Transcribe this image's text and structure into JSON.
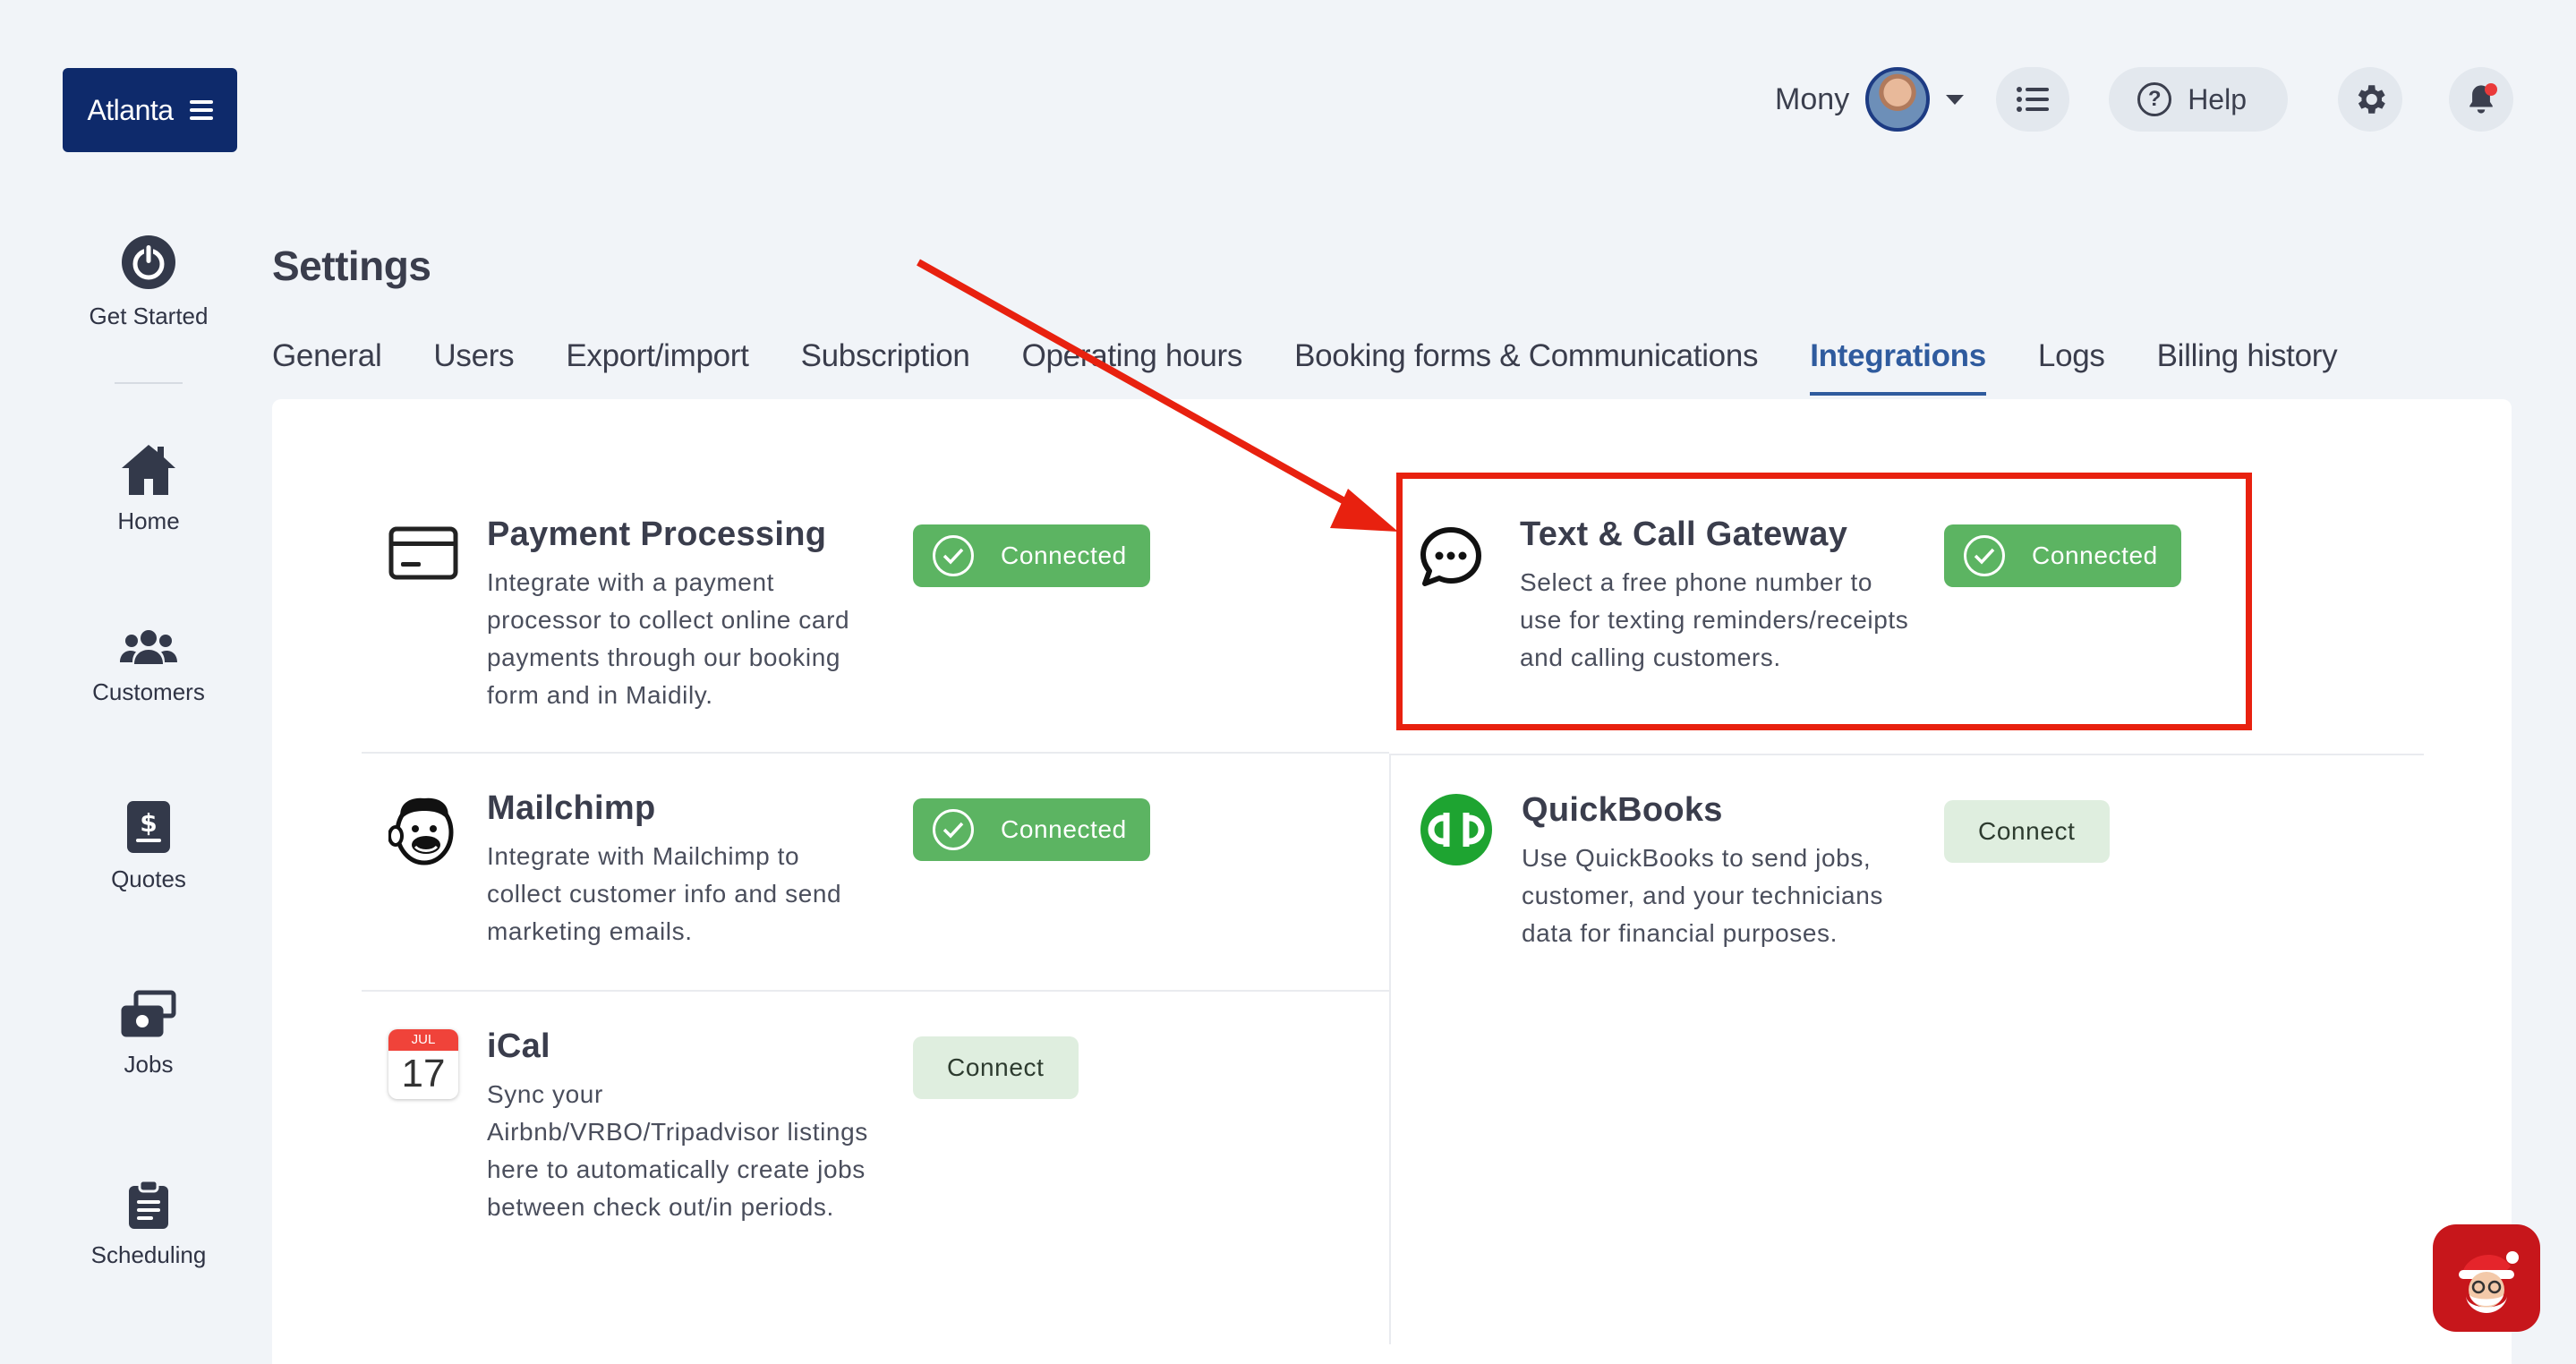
{
  "header": {
    "brand": "Atlanta",
    "user_name": "Mony",
    "help_label": "Help",
    "icons": [
      "menu-icon",
      "list-icon",
      "help-icon",
      "gear-icon",
      "bell-icon"
    ]
  },
  "sidebar": {
    "items": [
      {
        "label": "Get Started",
        "icon": "power-icon"
      },
      {
        "label": "Home",
        "icon": "home-icon"
      },
      {
        "label": "Customers",
        "icon": "users-icon"
      },
      {
        "label": "Quotes",
        "icon": "quote-icon"
      },
      {
        "label": "Jobs",
        "icon": "jobs-icon"
      },
      {
        "label": "Scheduling",
        "icon": "clipboard-icon"
      }
    ]
  },
  "page": {
    "title": "Settings",
    "tabs": [
      {
        "label": "General"
      },
      {
        "label": "Users"
      },
      {
        "label": "Export/import"
      },
      {
        "label": "Subscription"
      },
      {
        "label": "Operating hours"
      },
      {
        "label": "Booking forms & Communications"
      },
      {
        "label": "Integrations",
        "active": true
      },
      {
        "label": "Logs"
      },
      {
        "label": "Billing history"
      }
    ]
  },
  "integrations": {
    "payment": {
      "title": "Payment Processing",
      "desc": "Integrate with a payment processor to collect online card payments through our booking form and in Maidily.",
      "status": "Connected"
    },
    "gateway": {
      "title": "Text & Call Gateway",
      "desc": "Select a free phone number to use for texting reminders/receipts and calling customers.",
      "status": "Connected"
    },
    "mailchimp": {
      "title": "Mailchimp",
      "desc": "Integrate with Mailchimp to collect customer info and send marketing emails.",
      "status": "Connected"
    },
    "quickbooks": {
      "title": "QuickBooks",
      "desc": "Use QuickBooks to send jobs, customer, and your technicians data for financial purposes.",
      "action": "Connect"
    },
    "ical": {
      "title": "iCal",
      "desc": "Sync your Airbnb/VRBO/Tripadvisor listings here to automatically create jobs between check out/in periods.",
      "action": "Connect",
      "calendar_month": "JUL",
      "calendar_day": "17"
    }
  },
  "colors": {
    "brand": "#0e2a6b",
    "connected": "#5cb462",
    "connect": "#dfeedf",
    "active_tab": "#2f5b9e",
    "annotation": "#e8210f"
  }
}
